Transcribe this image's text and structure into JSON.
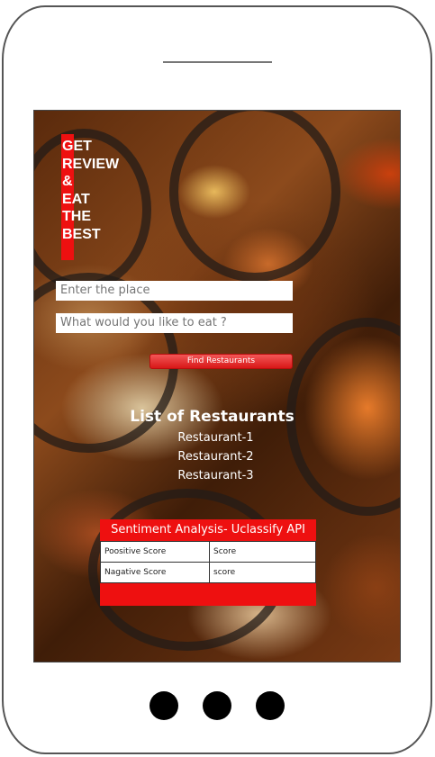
{
  "brand": {
    "lines": [
      "GET",
      "REVIEW",
      "&",
      "EAT",
      "THE",
      "BEST"
    ]
  },
  "search": {
    "place_placeholder": "Enter the place",
    "food_placeholder": "What would you like to eat ?"
  },
  "find_button": {
    "label": "Find Restaurants"
  },
  "restaurants": {
    "title": "List of Restaurants",
    "items": [
      "Restaurant-1",
      "Restaurant-2",
      "Restaurant-3"
    ]
  },
  "sentiment": {
    "title": "Sentiment Analysis- Uclassify API",
    "rows": [
      {
        "label": "Poositive Score",
        "value": "Score"
      },
      {
        "label": "Nagative Score",
        "value": "score"
      }
    ]
  },
  "colors": {
    "accent": "#ee1010",
    "text_on_image": "#ffffff"
  }
}
